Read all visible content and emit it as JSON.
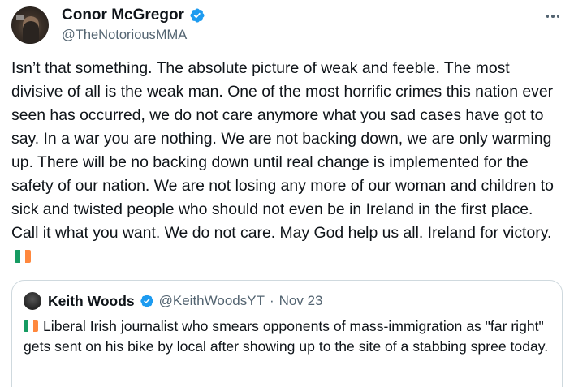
{
  "tweet": {
    "author": {
      "display_name": "Conor McGregor",
      "handle": "@TheNotoriousMMA",
      "verified": true,
      "avatar_icon": "avatar-photo"
    },
    "more_icon": "more-horizontal-icon",
    "text": "Isn’t that something. The absolute picture of weak and feeble. The most divisive of all is the weak man. One of the most horrific crimes this nation ever seen has occurred, we do not care anymore what you sad cases have got to say. In a war you are nothing. We are not backing down, we are only warming up. There will be no backing down until real change is implemented for the safety of our nation. We are not losing any more of our woman and children to sick and twisted people who should not even be in Ireland in the first place. Call it what you want. We do not care. May God help us all. Ireland for victory.",
    "trailing_emoji": "ireland-flag"
  },
  "quote": {
    "author": {
      "display_name": "Keith Woods",
      "handle": "@KeithWoodsYT",
      "verified": true
    },
    "separator": "·",
    "date": "Nov 23",
    "leading_emoji": "ireland-flag",
    "text": "Liberal Irish journalist who smears opponents of mass-immigration as \"far right\" gets sent on his bike by local after showing up to the site of a stabbing spree today."
  },
  "colors": {
    "text_primary": "#0f1419",
    "text_secondary": "#536471",
    "verified_blue": "#1d9bf0",
    "border": "#cfd9de",
    "flag_green": "#169b62",
    "flag_white": "#ffffff",
    "flag_orange": "#ff883e"
  }
}
